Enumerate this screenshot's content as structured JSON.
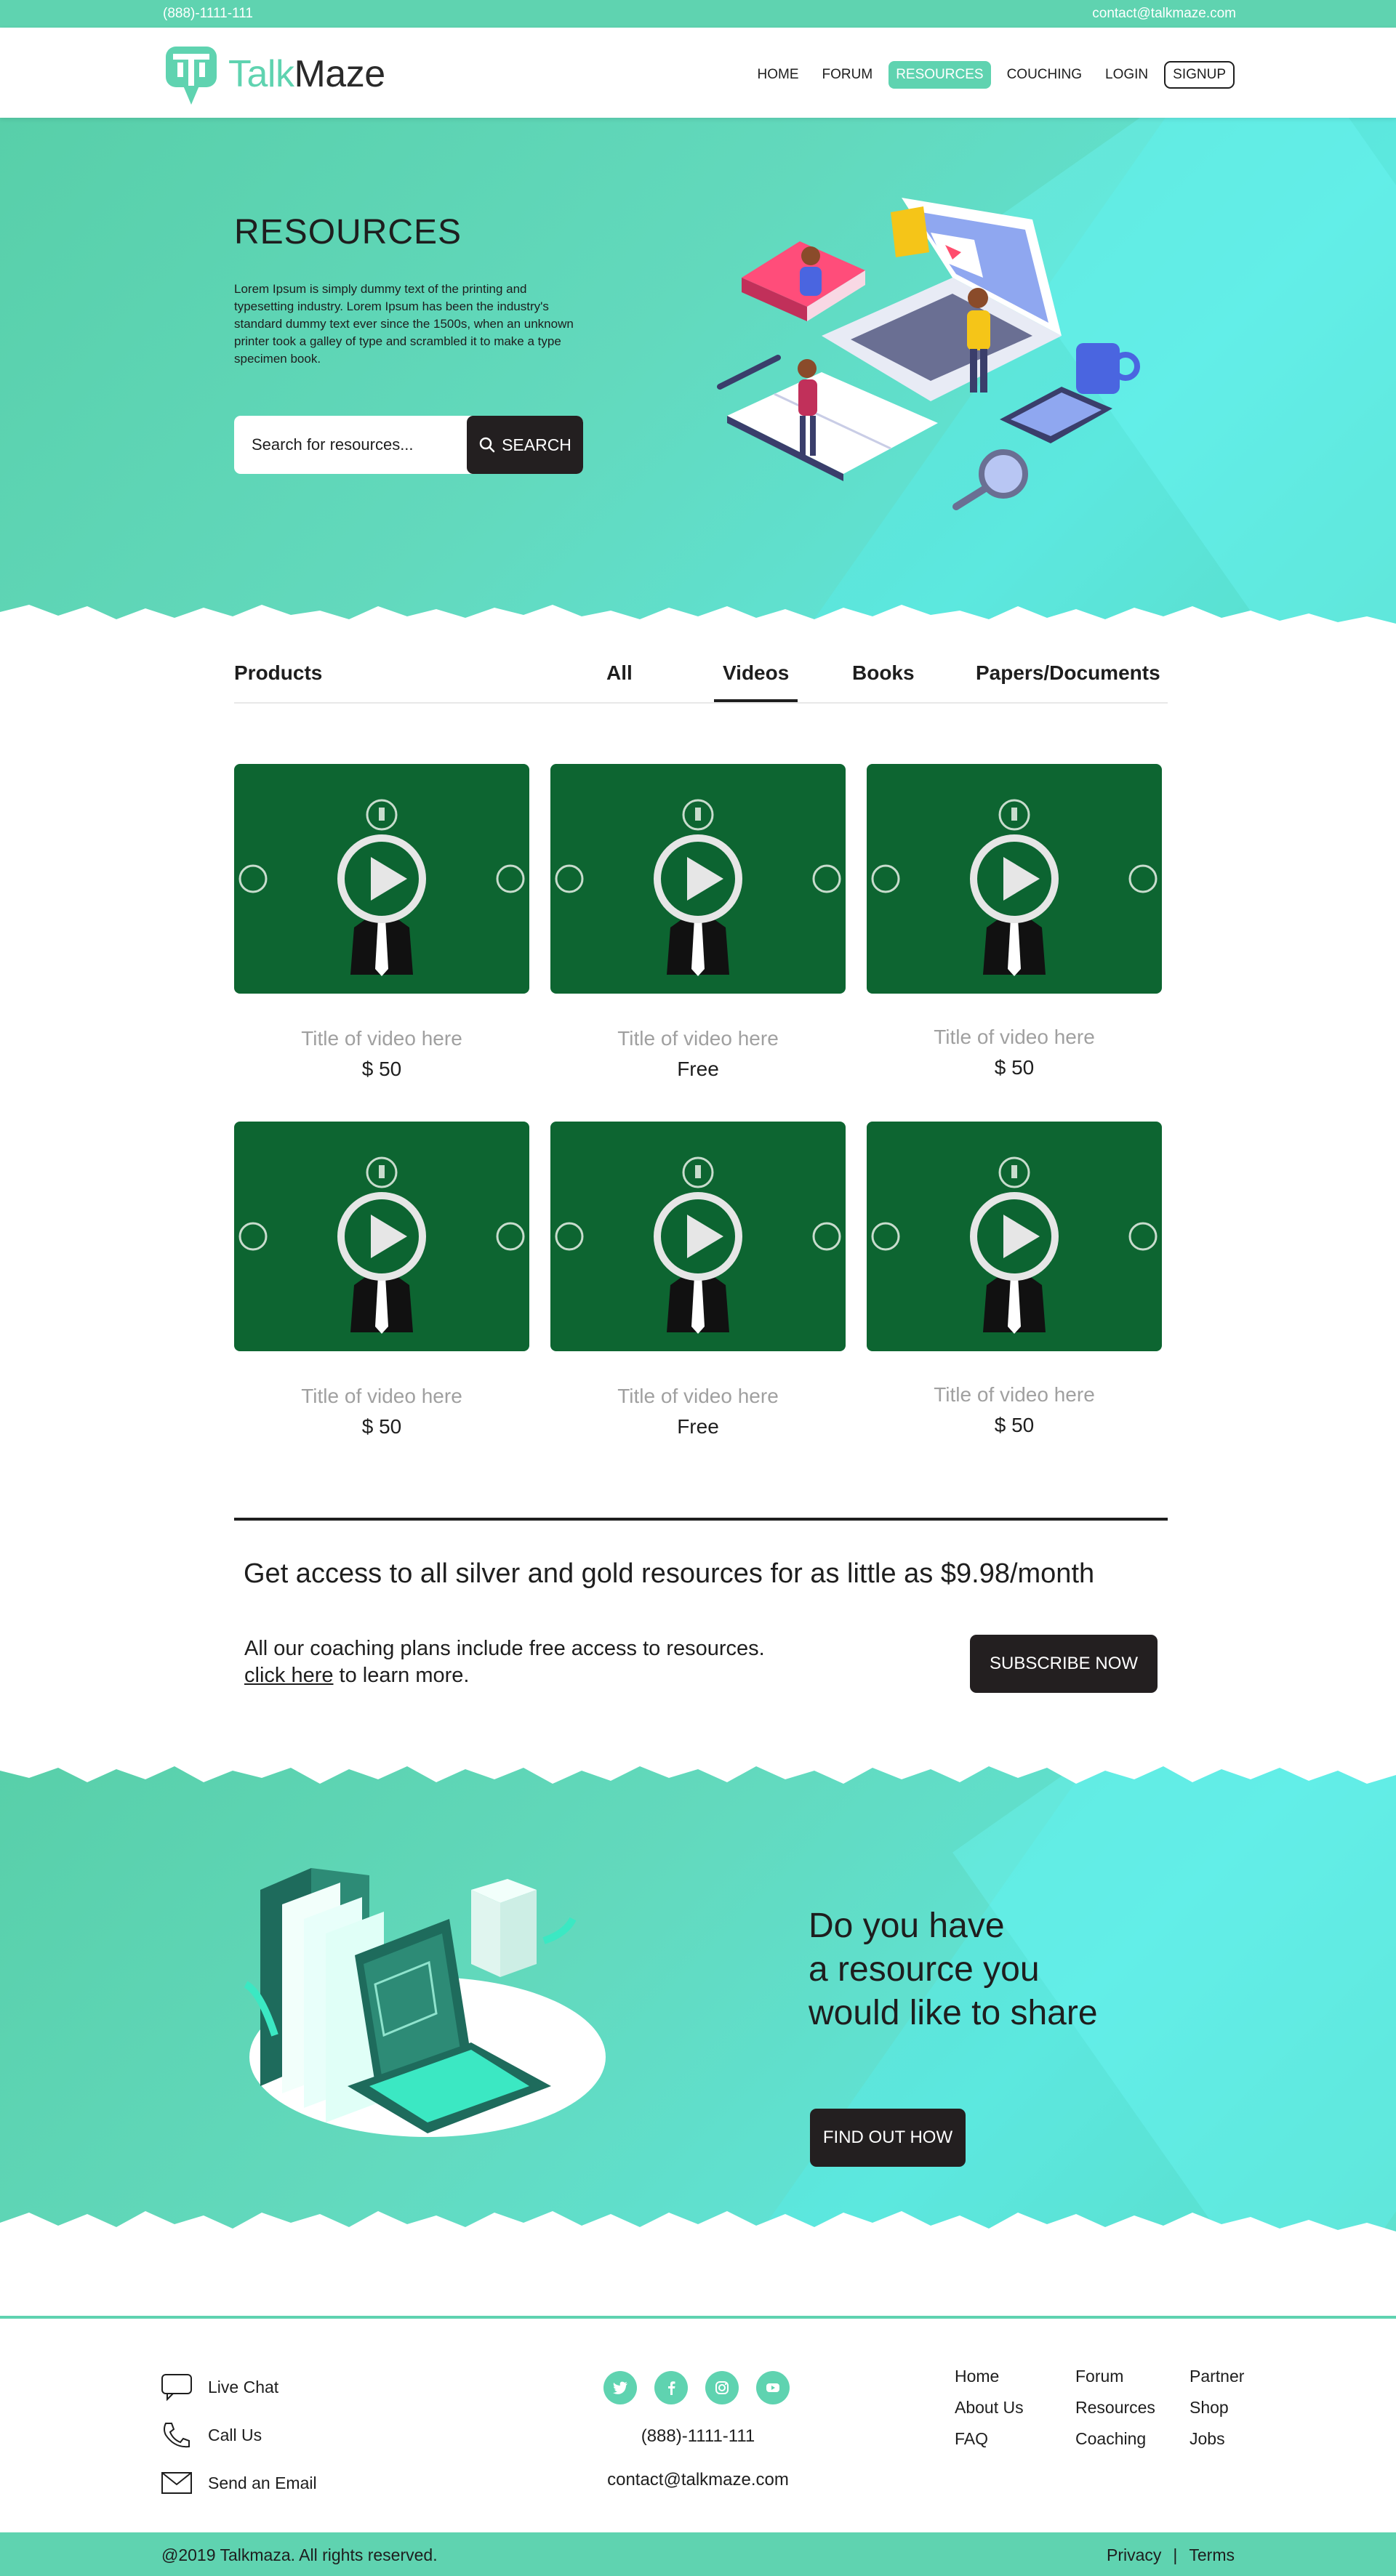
{
  "topbar": {
    "phone": "(888)-1111-111",
    "email": "contact@talkmaze.com"
  },
  "brand": {
    "name_part1": "Talk",
    "name_part2": "Maze"
  },
  "nav": [
    {
      "label": "HOME"
    },
    {
      "label": "FORUM"
    },
    {
      "label": "RESOURCES"
    },
    {
      "label": "COUCHING"
    },
    {
      "label": "LOGIN"
    },
    {
      "label": "SIGNUP"
    }
  ],
  "hero": {
    "title": "RESOURCES",
    "description": "Lorem Ipsum is simply dummy text of the printing and typesetting industry. Lorem Ipsum has been the industry's standard dummy text ever since the 1500s, when an unknown printer took a galley of type and scrambled it to make a type specimen book.",
    "search_placeholder": "Search for resources...",
    "search_button": "SEARCH"
  },
  "tabs": {
    "label": "Products",
    "items": [
      {
        "label": "All"
      },
      {
        "label": "Videos"
      },
      {
        "label": "Books"
      },
      {
        "label": "Papers/Documents"
      }
    ]
  },
  "videos": [
    {
      "title": "Title of video here",
      "price": "$ 50"
    },
    {
      "title": "Title of video here",
      "price": "Free"
    },
    {
      "title": "Title of video here",
      "price": "$ 50"
    },
    {
      "title": "Title of video here",
      "price": "$ 50"
    },
    {
      "title": "Title of video here",
      "price": "Free"
    },
    {
      "title": "Title of video here",
      "price": "$ 50"
    }
  ],
  "promo": {
    "headline": "Get access to all silver and gold resources for as little as $9.98/month",
    "line1": "All our coaching plans include free access to resources.",
    "link_text": "click here",
    "line2_rest": " to learn more.",
    "button": "SUBSCRIBE NOW"
  },
  "share": {
    "line1": "Do you have",
    "line2": "a resource you",
    "line3": "would like to share",
    "button": "FIND OUT HOW"
  },
  "footer": {
    "contact": [
      {
        "label": "Live Chat"
      },
      {
        "label": "Call Us"
      },
      {
        "label": "Send an Email"
      }
    ],
    "phone": "(888)-1111-111",
    "email": "contact@talkmaze.com",
    "col1": [
      "Home",
      "About Us",
      "FAQ"
    ],
    "col2": [
      "Forum",
      "Resources",
      "Coaching"
    ],
    "col3": [
      "Partner",
      "Shop",
      "Jobs"
    ],
    "copyright": "@2019 Talkmaza. All rights reserved.",
    "privacy": "Privacy",
    "separator": "|",
    "terms": "Terms"
  },
  "colors": {
    "accent": "#5fd3b0",
    "dark": "#231f20",
    "thumb_green": "#0d6531",
    "muted_text": "#a0a0a0"
  },
  "icons": {
    "social": [
      "twitter-icon",
      "facebook-icon",
      "instagram-icon",
      "youtube-icon"
    ]
  }
}
